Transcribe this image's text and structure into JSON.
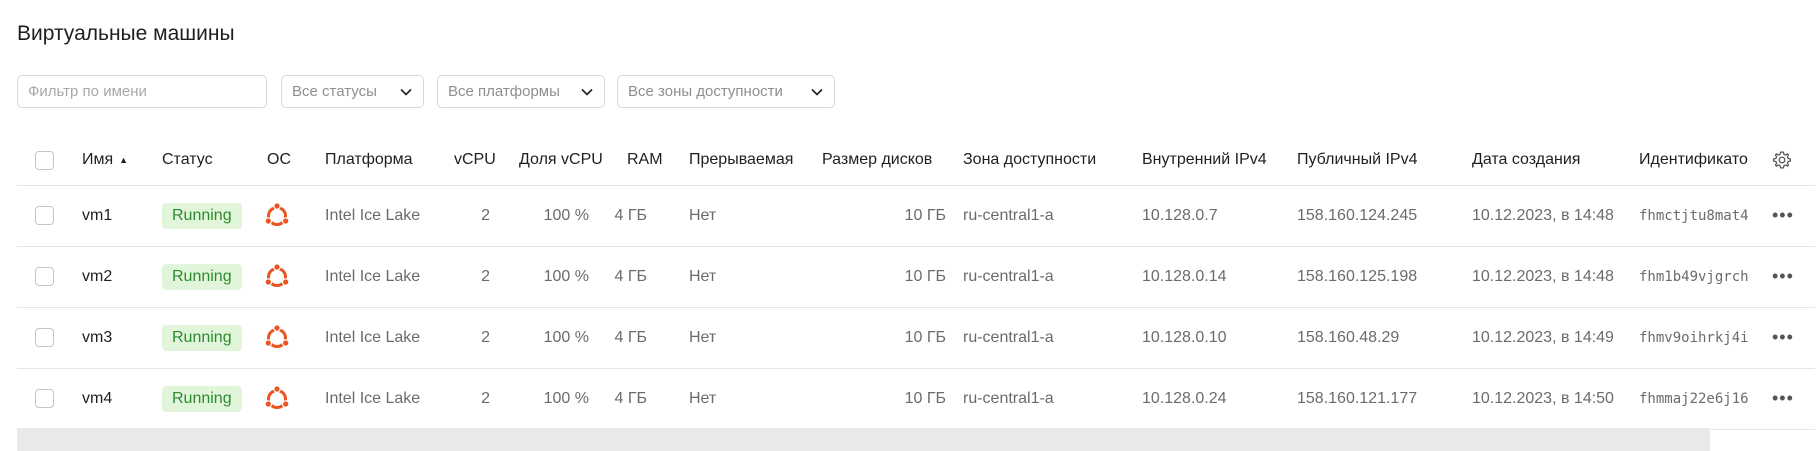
{
  "page": {
    "title": "Виртуальные машины"
  },
  "filters": {
    "name_placeholder": "Фильтр по имени",
    "status": "Все статусы",
    "platform": "Все платформы",
    "zone": "Все зоны доступности"
  },
  "table": {
    "columns": {
      "name": "Имя",
      "status": "Статус",
      "os": "ОС",
      "platform": "Платформа",
      "vcpu": "vCPU",
      "vcpu_share": "Доля vCPU",
      "ram": "RAM",
      "preemptible": "Прерываемая",
      "disk_size": "Размер дисков",
      "zone": "Зона доступности",
      "internal_ipv4": "Внутренний IPv4",
      "public_ipv4": "Публичный IPv4",
      "created": "Дата создания",
      "id": "Идентификато"
    },
    "status_color": "#2e8a2e",
    "status_bg": "#e1f5da",
    "os_icon": "ubuntu-icon",
    "os_color": "#e95420",
    "rows": [
      {
        "name": "vm1",
        "status": "Running",
        "platform": "Intel Ice Lake",
        "vcpu": "2",
        "vcpu_share": "100 %",
        "ram": "4 ГБ",
        "preemptible": "Нет",
        "disk_size": "10 ГБ",
        "zone": "ru-central1-a",
        "internal_ipv4": "10.128.0.7",
        "public_ipv4": "158.160.124.245",
        "created": "10.12.2023, в 14:48",
        "id": "fhmctjtu8mat4"
      },
      {
        "name": "vm2",
        "status": "Running",
        "platform": "Intel Ice Lake",
        "vcpu": "2",
        "vcpu_share": "100 %",
        "ram": "4 ГБ",
        "preemptible": "Нет",
        "disk_size": "10 ГБ",
        "zone": "ru-central1-a",
        "internal_ipv4": "10.128.0.14",
        "public_ipv4": "158.160.125.198",
        "created": "10.12.2023, в 14:48",
        "id": "fhm1b49vjgrch"
      },
      {
        "name": "vm3",
        "status": "Running",
        "platform": "Intel Ice Lake",
        "vcpu": "2",
        "vcpu_share": "100 %",
        "ram": "4 ГБ",
        "preemptible": "Нет",
        "disk_size": "10 ГБ",
        "zone": "ru-central1-a",
        "internal_ipv4": "10.128.0.10",
        "public_ipv4": "158.160.48.29",
        "created": "10.12.2023, в 14:49",
        "id": "fhmv9oihrkj4i"
      },
      {
        "name": "vm4",
        "status": "Running",
        "platform": "Intel Ice Lake",
        "vcpu": "2",
        "vcpu_share": "100 %",
        "ram": "4 ГБ",
        "preemptible": "Нет",
        "disk_size": "10 ГБ",
        "zone": "ru-central1-a",
        "internal_ipv4": "10.128.0.24",
        "public_ipv4": "158.160.121.177",
        "created": "10.12.2023, в 14:50",
        "id": "fhmmaj22e6j16"
      }
    ]
  }
}
